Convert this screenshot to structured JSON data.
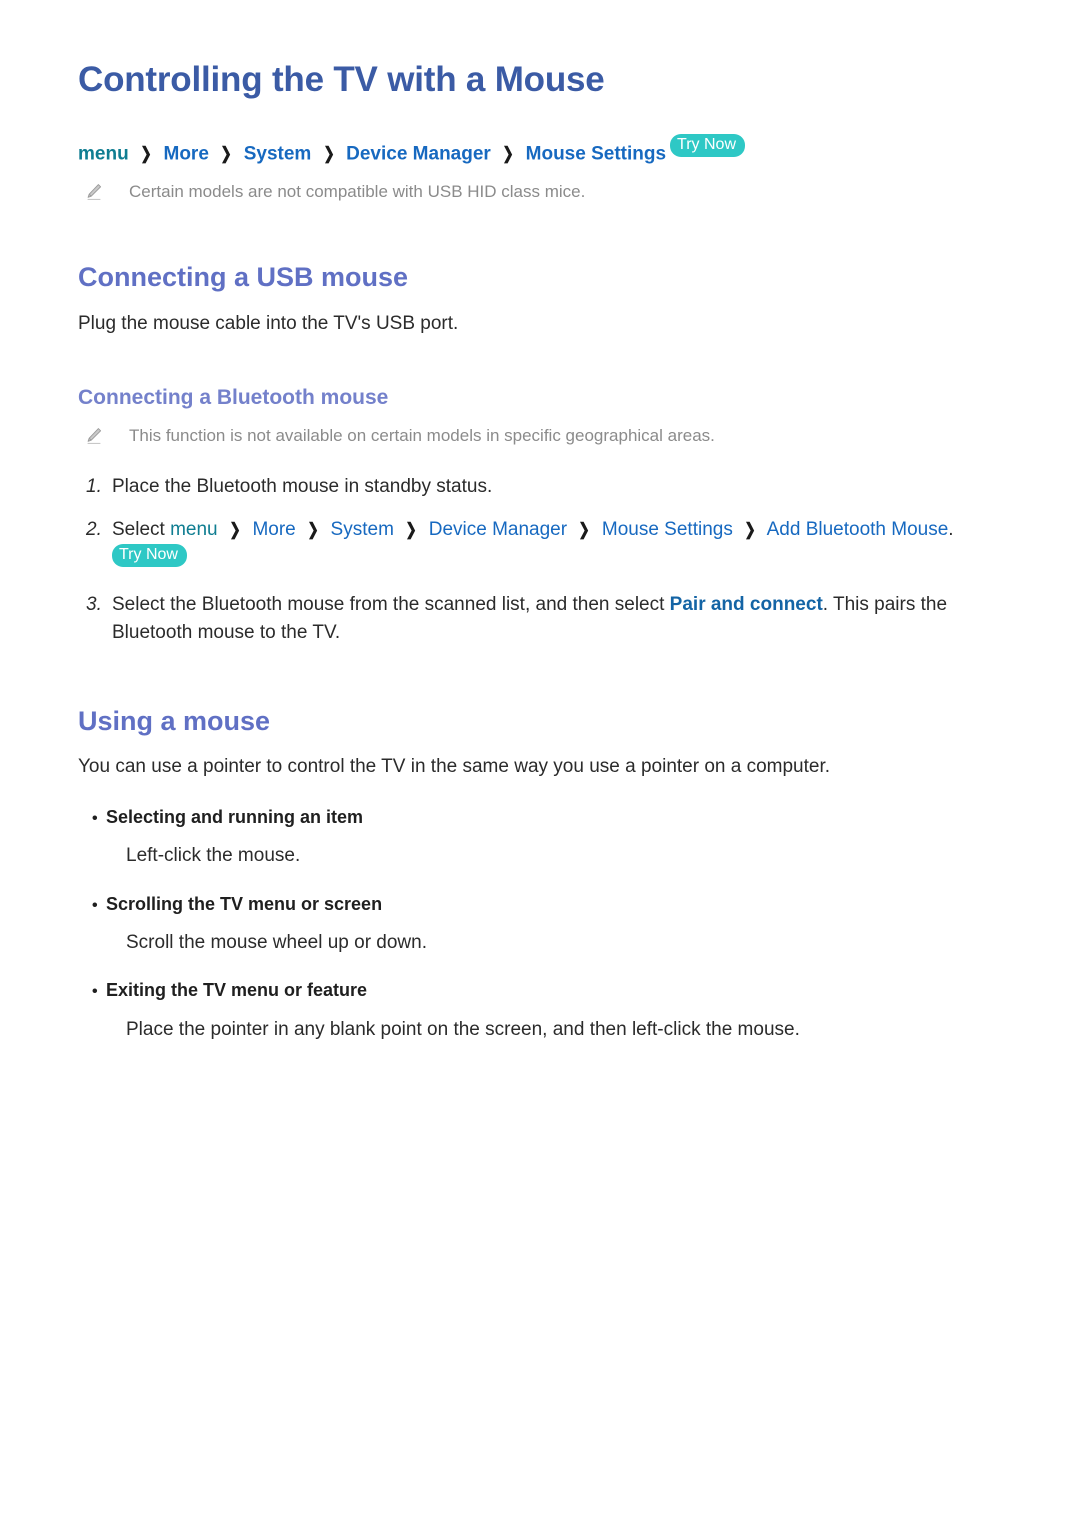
{
  "document": {
    "title": "Controlling the TV with a Mouse"
  },
  "breadcrumb": {
    "menu": "menu",
    "separator": "❯",
    "items": [
      "More",
      "System",
      "Device Manager",
      "Mouse Settings"
    ],
    "try_now": "Try Now"
  },
  "notes": {
    "usb_hid": "Certain models are not compatible with USB HID class mice.",
    "geo_restriction": "This function is not available on certain models in specific geographical areas."
  },
  "sections": {
    "usb_mouse": {
      "heading": "Connecting a USB mouse",
      "text": "Plug the mouse cable into the TV's USB port."
    },
    "bluetooth_mouse": {
      "heading": "Connecting a Bluetooth mouse",
      "steps": {
        "one": {
          "number": "1.",
          "text": "Place the Bluetooth mouse in standby status."
        },
        "two": {
          "number": "2.",
          "lead": "Select",
          "menu": "menu",
          "separator": "❯",
          "path": [
            "More",
            "System",
            "Device Manager",
            "Mouse Settings",
            "Add Bluetooth Mouse"
          ],
          "trailing": ".",
          "try_now": "Try Now"
        },
        "three": {
          "number": "3.",
          "text_before": "Select the Bluetooth mouse from the scanned list, and then select ",
          "link": "Pair and connect",
          "text_after": ". This pairs the Bluetooth mouse to the TV."
        }
      }
    },
    "using_mouse": {
      "heading": "Using a mouse",
      "intro": "You can use a pointer to control the TV in the same way you use a pointer on a computer.",
      "bullet": "•",
      "items": [
        {
          "title": "Selecting and running an item",
          "description": "Left-click the mouse."
        },
        {
          "title": "Scrolling the TV menu or screen",
          "description": "Scroll the mouse wheel up or down."
        },
        {
          "title": "Exiting the TV menu or feature",
          "description": "Place the pointer in any blank point on the screen, and then left-click the mouse."
        }
      ]
    }
  },
  "colors": {
    "title": "#3b5ba5",
    "h2": "#6070c4",
    "h3": "#7481cb",
    "link": "#1769c0",
    "menu_link": "#0f7d91",
    "strong_link": "#1464a5",
    "badge_bg": "#2ec8c5",
    "note_text": "#8b8b8b"
  }
}
